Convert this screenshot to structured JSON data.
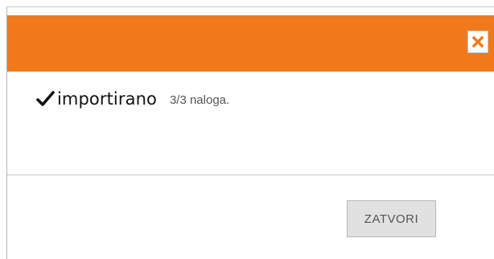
{
  "dialog": {
    "close_icon": "close-icon",
    "header_color": "#f07a1b"
  },
  "message": {
    "icon": "checkmark-icon",
    "status": "importirano",
    "result": "3/3 naloga."
  },
  "footer": {
    "close_button_label": "ZATVORI"
  }
}
